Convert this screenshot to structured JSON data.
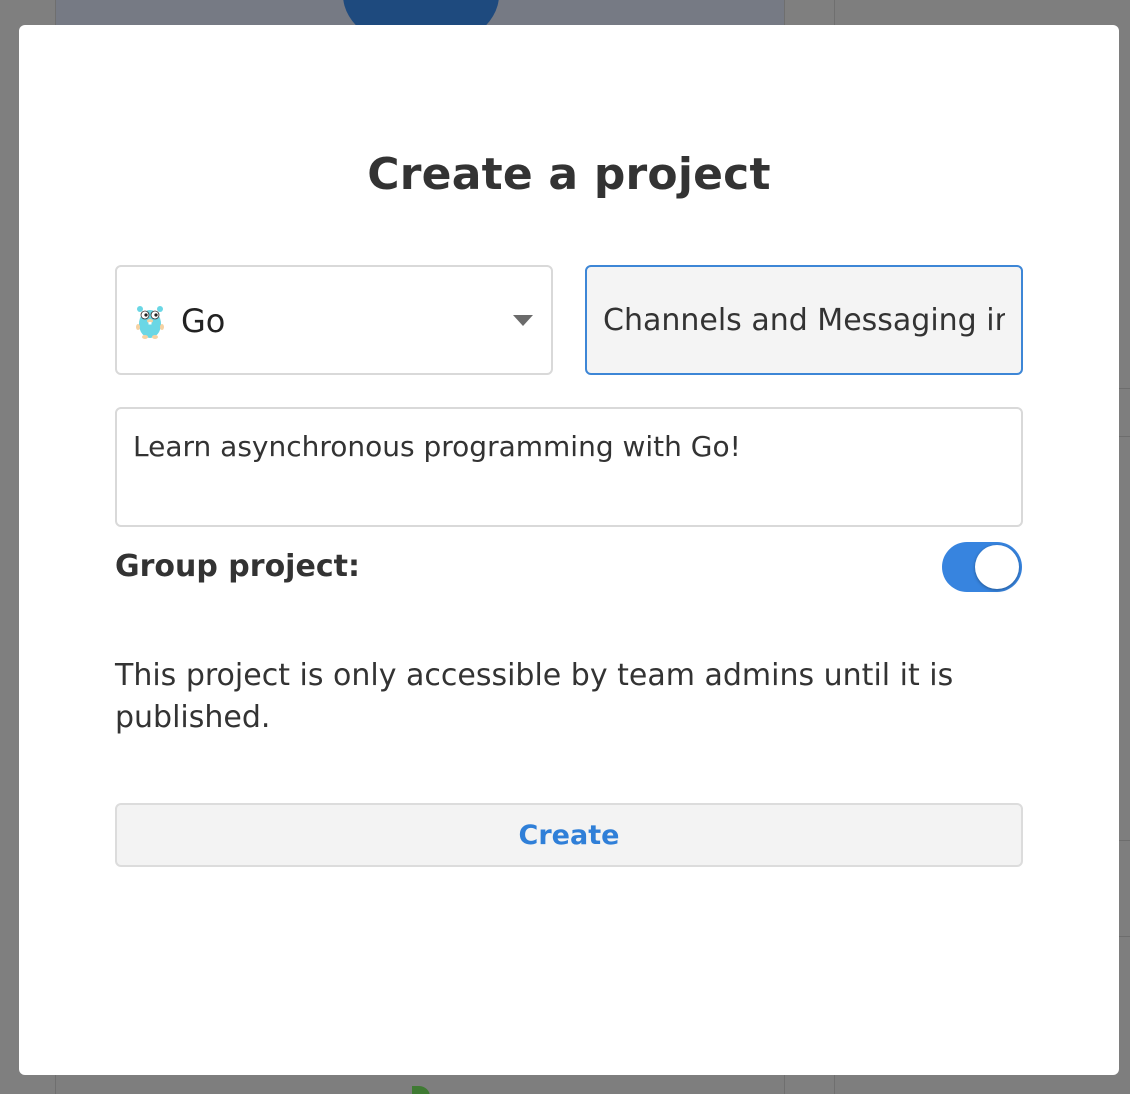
{
  "modal": {
    "title": "Create a project",
    "language": {
      "icon": "gopher-icon",
      "selected": "Go"
    },
    "project_title": {
      "value": "Channels and Messaging in Go"
    },
    "description": {
      "value": "Learn asynchronous programming with Go!"
    },
    "group_project": {
      "label": "Group project:",
      "enabled": true
    },
    "notice": "This project is only accessible by team admins until it is published.",
    "create_label": "Create"
  },
  "colors": {
    "accent": "#3784df",
    "button_text": "#2f7fd8",
    "focus_border": "#3d86d6"
  }
}
